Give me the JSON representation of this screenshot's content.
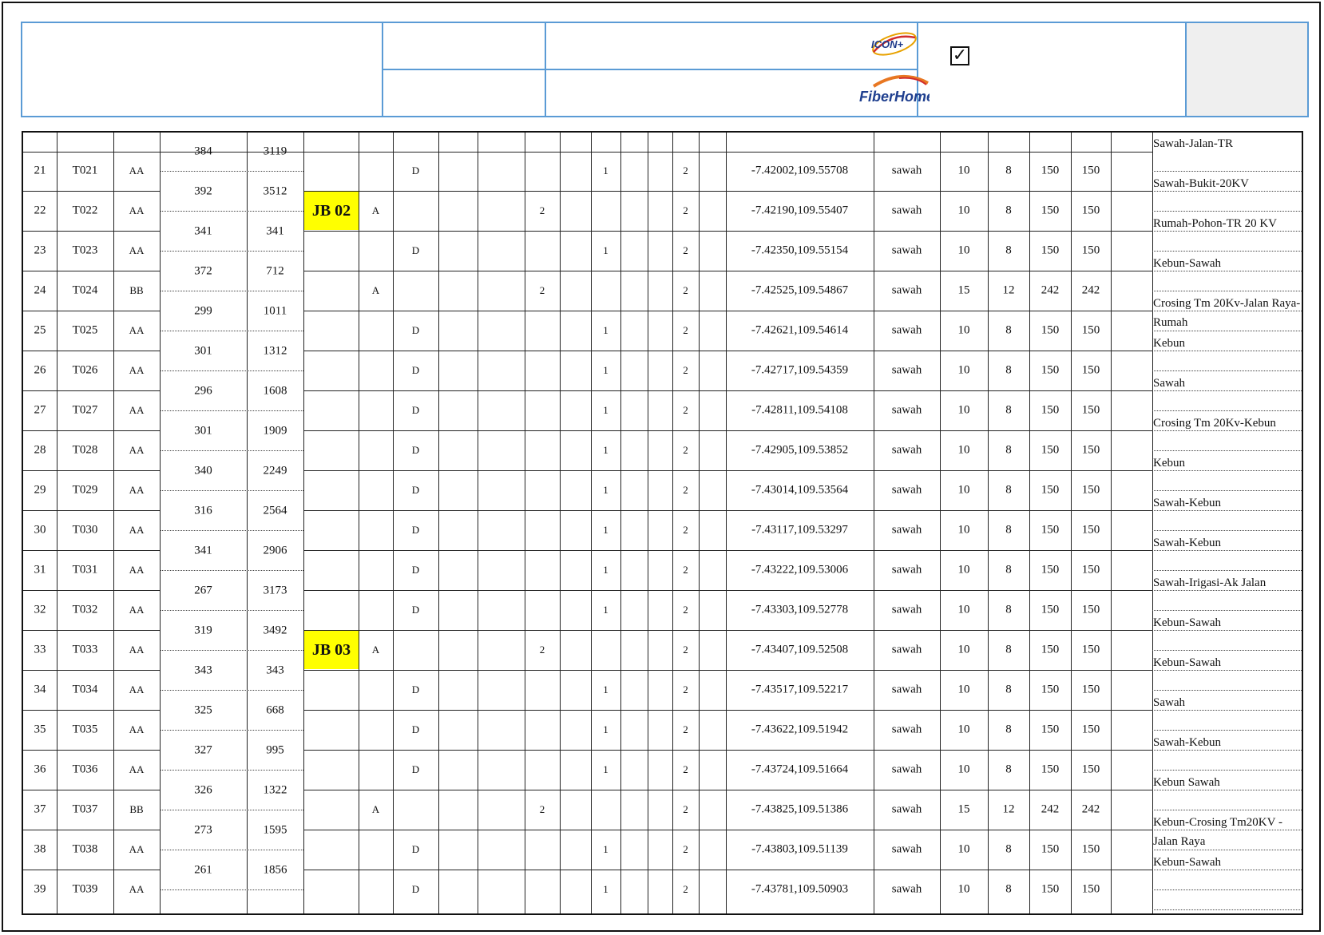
{
  "header": {
    "logo_top": "ICON+",
    "logo_bottom": "FiberHome",
    "checkbox_mark": "✓"
  },
  "rows": [
    {
      "no": "21",
      "tower": "T021",
      "type": "AA",
      "span": "384",
      "cum": "3119",
      "jb": "",
      "colA": "",
      "colD": "D",
      "c2": "",
      "c1": "1",
      "c2b": "2",
      "coord": "-7.42002,109.55708",
      "land": "sawah",
      "a": "10",
      "b": "8",
      "c": "150",
      "d": "150",
      "note": "Sawah-Jalan-TR"
    },
    {
      "no": "22",
      "tower": "T022",
      "type": "AA",
      "span": "392",
      "cum": "3512",
      "jb": "JB 02",
      "colA": "A",
      "colD": "",
      "c2": "2",
      "c1": "",
      "c2b": "2",
      "coord": "-7.42190,109.55407",
      "land": "sawah",
      "a": "10",
      "b": "8",
      "c": "150",
      "d": "150",
      "note": "Sawah-Bukit-20KV"
    },
    {
      "no": "23",
      "tower": "T023",
      "type": "AA",
      "span": "341",
      "cum": "341",
      "jb": "",
      "colA": "",
      "colD": "D",
      "c2": "",
      "c1": "1",
      "c2b": "2",
      "coord": "-7.42350,109.55154",
      "land": "sawah",
      "a": "10",
      "b": "8",
      "c": "150",
      "d": "150",
      "note": "Rumah-Pohon-TR 20 KV"
    },
    {
      "no": "24",
      "tower": "T024",
      "type": "BB",
      "span": "372",
      "cum": "712",
      "jb": "",
      "colA": "A",
      "colD": "",
      "c2": "2",
      "c1": "",
      "c2b": "2",
      "coord": "-7.42525,109.54867",
      "land": "sawah",
      "a": "15",
      "b": "12",
      "c": "242",
      "d": "242",
      "note": "Kebun-Sawah"
    },
    {
      "no": "25",
      "tower": "T025",
      "type": "AA",
      "span": "299",
      "cum": "1011",
      "jb": "",
      "colA": "",
      "colD": "D",
      "c2": "",
      "c1": "1",
      "c2b": "2",
      "coord": "-7.42621,109.54614",
      "land": "sawah",
      "a": "10",
      "b": "8",
      "c": "150",
      "d": "150",
      "note": "Crosing Tm 20Kv-Jalan Raya-Rumah"
    },
    {
      "no": "26",
      "tower": "T026",
      "type": "AA",
      "span": "301",
      "cum": "1312",
      "jb": "",
      "colA": "",
      "colD": "D",
      "c2": "",
      "c1": "1",
      "c2b": "2",
      "coord": "-7.42717,109.54359",
      "land": "sawah",
      "a": "10",
      "b": "8",
      "c": "150",
      "d": "150",
      "note": "Kebun"
    },
    {
      "no": "27",
      "tower": "T027",
      "type": "AA",
      "span": "296",
      "cum": "1608",
      "jb": "",
      "colA": "",
      "colD": "D",
      "c2": "",
      "c1": "1",
      "c2b": "2",
      "coord": "-7.42811,109.54108",
      "land": "sawah",
      "a": "10",
      "b": "8",
      "c": "150",
      "d": "150",
      "note": "Sawah"
    },
    {
      "no": "28",
      "tower": "T028",
      "type": "AA",
      "span": "301",
      "cum": "1909",
      "jb": "",
      "colA": "",
      "colD": "D",
      "c2": "",
      "c1": "1",
      "c2b": "2",
      "coord": "-7.42905,109.53852",
      "land": "sawah",
      "a": "10",
      "b": "8",
      "c": "150",
      "d": "150",
      "note": "Crosing Tm 20Kv-Kebun"
    },
    {
      "no": "29",
      "tower": "T029",
      "type": "AA",
      "span": "340",
      "cum": "2249",
      "jb": "",
      "colA": "",
      "colD": "D",
      "c2": "",
      "c1": "1",
      "c2b": "2",
      "coord": "-7.43014,109.53564",
      "land": "sawah",
      "a": "10",
      "b": "8",
      "c": "150",
      "d": "150",
      "note": "Kebun"
    },
    {
      "no": "30",
      "tower": "T030",
      "type": "AA",
      "span": "316",
      "cum": "2564",
      "jb": "",
      "colA": "",
      "colD": "D",
      "c2": "",
      "c1": "1",
      "c2b": "2",
      "coord": "-7.43117,109.53297",
      "land": "sawah",
      "a": "10",
      "b": "8",
      "c": "150",
      "d": "150",
      "note": "Sawah-Kebun"
    },
    {
      "no": "31",
      "tower": "T031",
      "type": "AA",
      "span": "341",
      "cum": "2906",
      "jb": "",
      "colA": "",
      "colD": "D",
      "c2": "",
      "c1": "1",
      "c2b": "2",
      "coord": "-7.43222,109.53006",
      "land": "sawah",
      "a": "10",
      "b": "8",
      "c": "150",
      "d": "150",
      "note": "Sawah-Kebun"
    },
    {
      "no": "32",
      "tower": "T032",
      "type": "AA",
      "span": "267",
      "cum": "3173",
      "jb": "",
      "colA": "",
      "colD": "D",
      "c2": "",
      "c1": "1",
      "c2b": "2",
      "coord": "-7.43303,109.52778",
      "land": "sawah",
      "a": "10",
      "b": "8",
      "c": "150",
      "d": "150",
      "note": "Sawah-Irigasi-Ak Jalan"
    },
    {
      "no": "33",
      "tower": "T033",
      "type": "AA",
      "span": "319",
      "cum": "3492",
      "jb": "JB 03",
      "colA": "A",
      "colD": "",
      "c2": "2",
      "c1": "",
      "c2b": "2",
      "coord": "-7.43407,109.52508",
      "land": "sawah",
      "a": "10",
      "b": "8",
      "c": "150",
      "d": "150",
      "note": "Kebun-Sawah"
    },
    {
      "no": "34",
      "tower": "T034",
      "type": "AA",
      "span": "343",
      "cum": "343",
      "jb": "",
      "colA": "",
      "colD": "D",
      "c2": "",
      "c1": "1",
      "c2b": "2",
      "coord": "-7.43517,109.52217",
      "land": "sawah",
      "a": "10",
      "b": "8",
      "c": "150",
      "d": "150",
      "note": "Kebun-Sawah"
    },
    {
      "no": "35",
      "tower": "T035",
      "type": "AA",
      "span": "325",
      "cum": "668",
      "jb": "",
      "colA": "",
      "colD": "D",
      "c2": "",
      "c1": "1",
      "c2b": "2",
      "coord": "-7.43622,109.51942",
      "land": "sawah",
      "a": "10",
      "b": "8",
      "c": "150",
      "d": "150",
      "note": "Sawah"
    },
    {
      "no": "36",
      "tower": "T036",
      "type": "AA",
      "span": "327",
      "cum": "995",
      "jb": "",
      "colA": "",
      "colD": "D",
      "c2": "",
      "c1": "1",
      "c2b": "2",
      "coord": "-7.43724,109.51664",
      "land": "sawah",
      "a": "10",
      "b": "8",
      "c": "150",
      "d": "150",
      "note": "Sawah-Kebun"
    },
    {
      "no": "37",
      "tower": "T037",
      "type": "BB",
      "span": "326",
      "cum": "1322",
      "jb": "",
      "colA": "A",
      "colD": "",
      "c2": "2",
      "c1": "",
      "c2b": "2",
      "coord": "-7.43825,109.51386",
      "land": "sawah",
      "a": "15",
      "b": "12",
      "c": "242",
      "d": "242",
      "note": "Kebun Sawah"
    },
    {
      "no": "38",
      "tower": "T038",
      "type": "AA",
      "span": "273",
      "cum": "1595",
      "jb": "",
      "colA": "",
      "colD": "D",
      "c2": "",
      "c1": "1",
      "c2b": "2",
      "coord": "-7.43803,109.51139",
      "land": "sawah",
      "a": "10",
      "b": "8",
      "c": "150",
      "d": "150",
      "note": "Kebun-Crosing Tm20KV - Jalan Raya"
    },
    {
      "no": "39",
      "tower": "T039",
      "type": "AA",
      "span": "261",
      "cum": "1856",
      "jb": "",
      "colA": "",
      "colD": "D",
      "c2": "",
      "c1": "1",
      "c2b": "2",
      "coord": "-7.43781,109.50903",
      "land": "sawah",
      "a": "10",
      "b": "8",
      "c": "150",
      "d": "150",
      "note": "Kebun-Sawah"
    }
  ]
}
